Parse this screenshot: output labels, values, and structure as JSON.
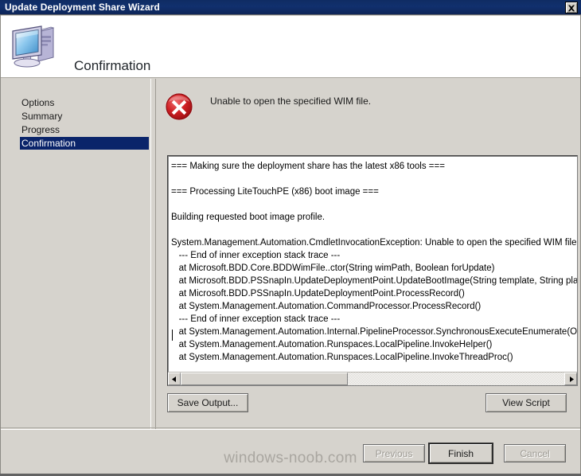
{
  "window": {
    "title": "Update Deployment Share Wizard",
    "close_label": "Close",
    "close_icon": "close-icon"
  },
  "header": {
    "title": "Confirmation",
    "icon": "computer-icon"
  },
  "sidebar": {
    "items": [
      {
        "label": "Options",
        "selected": false
      },
      {
        "label": "Summary",
        "selected": false
      },
      {
        "label": "Progress",
        "selected": false
      },
      {
        "label": "Confirmation",
        "selected": true
      }
    ]
  },
  "content": {
    "status": {
      "icon": "error-icon",
      "message": "Unable to open the specified WIM file."
    },
    "output_lines": [
      "=== Making sure the deployment share has the latest x86 tools ===",
      "",
      "=== Processing LiteTouchPE (x86) boot image ===",
      "",
      "Building requested boot image profile.",
      "",
      "System.Management.Automation.CmdletInvocationException: Unable to open the specified WIM file. --->",
      "   --- End of inner exception stack trace ---",
      "   at Microsoft.BDD.Core.BDDWimFile..ctor(String wimPath, Boolean forUpdate)",
      "   at Microsoft.BDD.PSSnapIn.UpdateDeploymentPoint.UpdateBootImage(String template, String platform",
      "   at Microsoft.BDD.PSSnapIn.UpdateDeploymentPoint.ProcessRecord()",
      "   at System.Management.Automation.CommandProcessor.ProcessRecord()",
      "   --- End of inner exception stack trace ---",
      "   at System.Management.Automation.Internal.PipelineProcessor.SynchronousExecuteEnumerate(Object",
      "   at System.Management.Automation.Runspaces.LocalPipeline.InvokeHelper()",
      "   at System.Management.Automation.Runspaces.LocalPipeline.InvokeThreadProc()"
    ],
    "scrollbar": {
      "left_arrow": "◀",
      "right_arrow": "▶"
    },
    "save_output_label": "Save Output...",
    "view_script_label": "View Script"
  },
  "footer": {
    "previous_label": "Previous",
    "finish_label": "Finish",
    "cancel_label": "Cancel",
    "watermark": "windows-noob.com"
  },
  "colors": {
    "titlebar": "#11306e",
    "selection": "#0a246a",
    "dialog_face": "#d6d3cd",
    "error_red": "#c9181b",
    "watermark": "#a9a6a0"
  }
}
